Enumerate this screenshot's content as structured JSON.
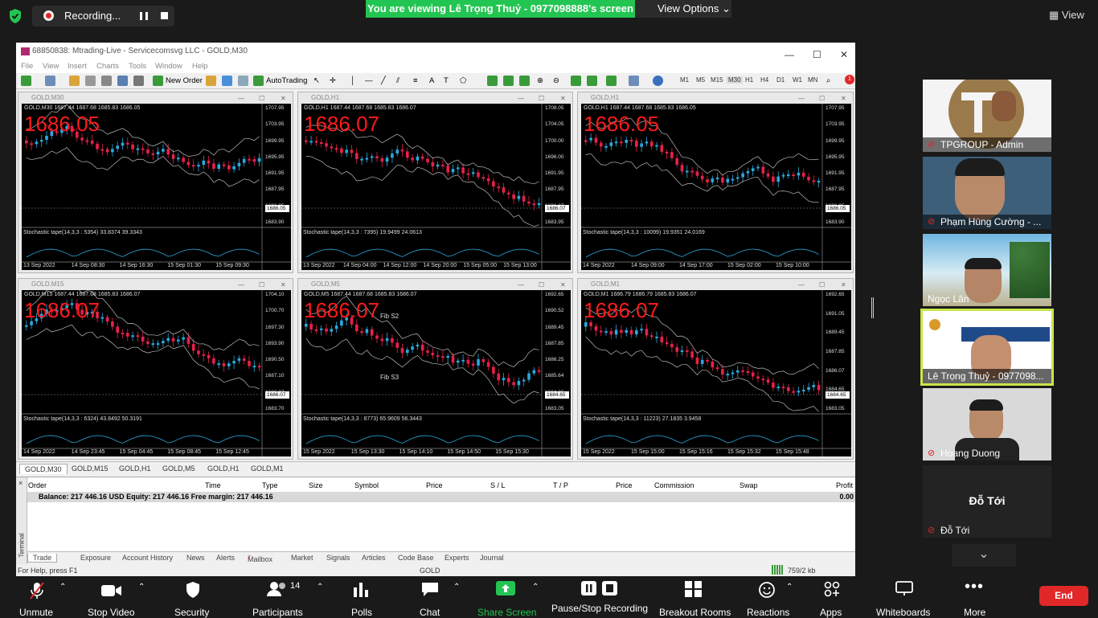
{
  "zoom": {
    "recording_label": "Recording...",
    "viewing_banner": "You are viewing Lê Trọng Thuỷ - 0977098888's screen",
    "view_options": "View Options",
    "view_label": "View"
  },
  "mt": {
    "title": "68850838: Mtrading-Live - Servicecomsvg LLC - GOLD,M30",
    "menu": [
      "File",
      "View",
      "Insert",
      "Charts",
      "Tools",
      "Window",
      "Help"
    ],
    "new_order": "New Order",
    "autotrading": "AutoTrading",
    "timeframes": [
      "M1",
      "M5",
      "M15",
      "M30",
      "H1",
      "H4",
      "D1",
      "W1",
      "MN"
    ],
    "notification_count": "1"
  },
  "charts": [
    {
      "title": "GOLD,M30",
      "big": "1686.05",
      "ohlc": "GOLD,M30  1687.44 1687.68 1685.83 1686.05",
      "stoch": "Stochastic tape(14,3,3 : 5354) 33.8374 39.3343",
      "prices": [
        "1707.95",
        "1703.95",
        "1699.95",
        "1695.95",
        "1691.95",
        "1687.95",
        "1686.05",
        "1683.90"
      ],
      "times": [
        "13 Sep 2022",
        "14 Sep 08:30",
        "14 Sep 16:30",
        "15 Sep 01:30",
        "15 Sep 09:30"
      ]
    },
    {
      "title": "GOLD,H1",
      "big": "1686.07",
      "ohlc": "GOLD,H1  1687.44 1687.68 1685.83 1686.07",
      "stoch": "Stochastic tape(14,3,3 : 7395) 19.9499 24.0613",
      "prices": [
        "1708.05",
        "1704.05",
        "1700.00",
        "1696.00",
        "1691.95",
        "1687.95",
        "1686.07",
        "1683.95"
      ],
      "times": [
        "13 Sep 2022",
        "14 Sep 04:00",
        "14 Sep 12:00",
        "14 Sep 20:00",
        "15 Sep 05:00",
        "15 Sep 13:00"
      ]
    },
    {
      "title": "GOLD,H1",
      "big": "1686.05",
      "ohlc": "GOLD,H1  1687.44 1687.68 1685.83 1686.05",
      "stoch": "Stochastic tape(14,3,3 : 10099) 19.9351 24.0169",
      "prices": [
        "1707.95",
        "1703.95",
        "1699.95",
        "1695.95",
        "1691.95",
        "1687.95",
        "1686.05",
        "1683.90"
      ],
      "times": [
        "14 Sep 2022",
        "14 Sep 09:00",
        "14 Sep 17:00",
        "15 Sep 02:00",
        "15 Sep 10:00"
      ]
    },
    {
      "title": "GOLD,M15",
      "big": "1686.07",
      "ohlc": "GOLD,M15  1687.44 1687.68 1685.83 1686.07",
      "stoch": "Stochastic tape(14,3,3 : 6324) 43.8492 50.3191",
      "prices": [
        "1704.10",
        "1700.70",
        "1697.30",
        "1693.90",
        "1690.50",
        "1687.10",
        "1686.07",
        "1683.70"
      ],
      "times": [
        "14 Sep 2022",
        "14 Sep 23:45",
        "15 Sep 04:45",
        "15 Sep 08:45",
        "15 Sep 12:45"
      ]
    },
    {
      "title": "GOLD,M5",
      "big": "1686.07",
      "ohlc": "GOLD,M5  1687.44 1687.68 1685.83 1686.07",
      "stoch": "Stochastic tape(14,3,3 : 8773) 65.9609 56.3443",
      "prices": [
        "1692.65",
        "1690.52",
        "1689.45",
        "1687.85",
        "1686.25",
        "1685.64",
        "1684.65",
        "1683.05"
      ],
      "times": [
        "15 Sep 2022",
        "15 Sep 13:30",
        "15 Sep 14:10",
        "15 Sep 14:50",
        "15 Sep 15:30"
      ],
      "labels": [
        "Fib S2",
        "Fib S3"
      ]
    },
    {
      "title": "GOLD,M1",
      "big": "1686.07",
      "ohlc": "GOLD,M1  1686.79 1686.79 1685.83 1686.07",
      "stoch": "Stochastic tape(14,3,3 : 11223) 27.1835 3.9458",
      "prices": [
        "1692.65",
        "1691.05",
        "1689.45",
        "1687.85",
        "1686.07",
        "1684.65",
        "1683.05"
      ],
      "times": [
        "15 Sep 2022",
        "15 Sep 15:00",
        "15 Sep 15:16",
        "15 Sep 15:32",
        "15 Sep 15:48"
      ]
    }
  ],
  "chart_tabs": [
    "GOLD,M30",
    "GOLD,M15",
    "GOLD,H1",
    "GOLD,M5",
    "GOLD,H1",
    "GOLD,M1"
  ],
  "terminal": {
    "headers": [
      "Order",
      "Time",
      "Type",
      "Size",
      "Symbol",
      "Price",
      "S / L",
      "T / P",
      "Price",
      "Commission",
      "Swap",
      "Profit"
    ],
    "balance": "Balance: 217 446.16 USD  Equity: 217 446.16  Free margin: 217 446.16",
    "profit": "0.00",
    "tabs": [
      "Trade",
      "Exposure",
      "Account History",
      "News",
      "Alerts",
      "Mailbox",
      "Market",
      "Signals",
      "Articles",
      "Code Base",
      "Experts",
      "Journal"
    ],
    "mailbox_count": "7",
    "side_label": "Terminal"
  },
  "statusbar": {
    "help": "For Help, press F1",
    "symbol": "GOLD",
    "traffic": "759/2 kb"
  },
  "participants": [
    {
      "name": "TPGROUP - Admin",
      "muted": true
    },
    {
      "name": "Phạm Hùng Cường - ...",
      "muted": true
    },
    {
      "name": "Ngọc Lân",
      "muted": false
    },
    {
      "name": "Lê Trọng Thuỷ - 0977098...",
      "muted": false
    },
    {
      "name": "Hoang Duong",
      "muted": true
    },
    {
      "name": "Đỗ Tới",
      "muted": true,
      "big": "Đỗ Tới"
    }
  ],
  "bottombar": {
    "unmute": "Unmute",
    "stop_video": "Stop Video",
    "security": "Security",
    "participants": "Participants",
    "participants_count": "14",
    "polls": "Polls",
    "chat": "Chat",
    "share_screen": "Share Screen",
    "pause_stop": "Pause/Stop Recording",
    "breakout": "Breakout Rooms",
    "reactions": "Reactions",
    "apps": "Apps",
    "whiteboards": "Whiteboards",
    "more": "More",
    "end": "End"
  },
  "colors": {
    "zoom_green": "#23c552",
    "end_red": "#e02828",
    "bull": "#2aa9e0",
    "bear": "#e8214a"
  }
}
